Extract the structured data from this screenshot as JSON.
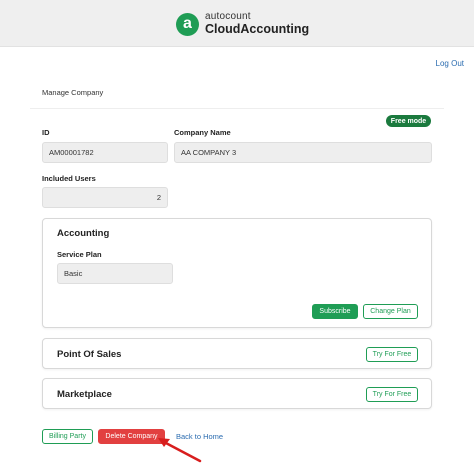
{
  "header": {
    "brand_top": "autocount",
    "brand_bottom": "CloudAccounting",
    "logo_letter": "a",
    "logout_label": "Log Out"
  },
  "page": {
    "title": "Manage Company",
    "badge": "Free mode"
  },
  "fields": {
    "id_label": "ID",
    "id_value": "AM00001782",
    "company_label": "Company Name",
    "company_value": "AA COMPANY 3",
    "users_label": "Included Users",
    "users_value": "2"
  },
  "accounting": {
    "title": "Accounting",
    "plan_label": "Service Plan",
    "plan_value": "Basic",
    "subscribe_label": "Subscribe",
    "change_plan_label": "Change Plan"
  },
  "pos": {
    "title": "Point Of Sales",
    "try_label": "Try For Free"
  },
  "marketplace": {
    "title": "Marketplace",
    "try_label": "Try For Free"
  },
  "footer": {
    "billing_label": "Billing Party",
    "delete_label": "Delete Company",
    "back_label": "Back to Home"
  },
  "colors": {
    "brand_green": "#1f9d55",
    "badge_green": "#1b7a3e",
    "danger_red": "#e24040",
    "link_blue": "#2b6cb0"
  }
}
